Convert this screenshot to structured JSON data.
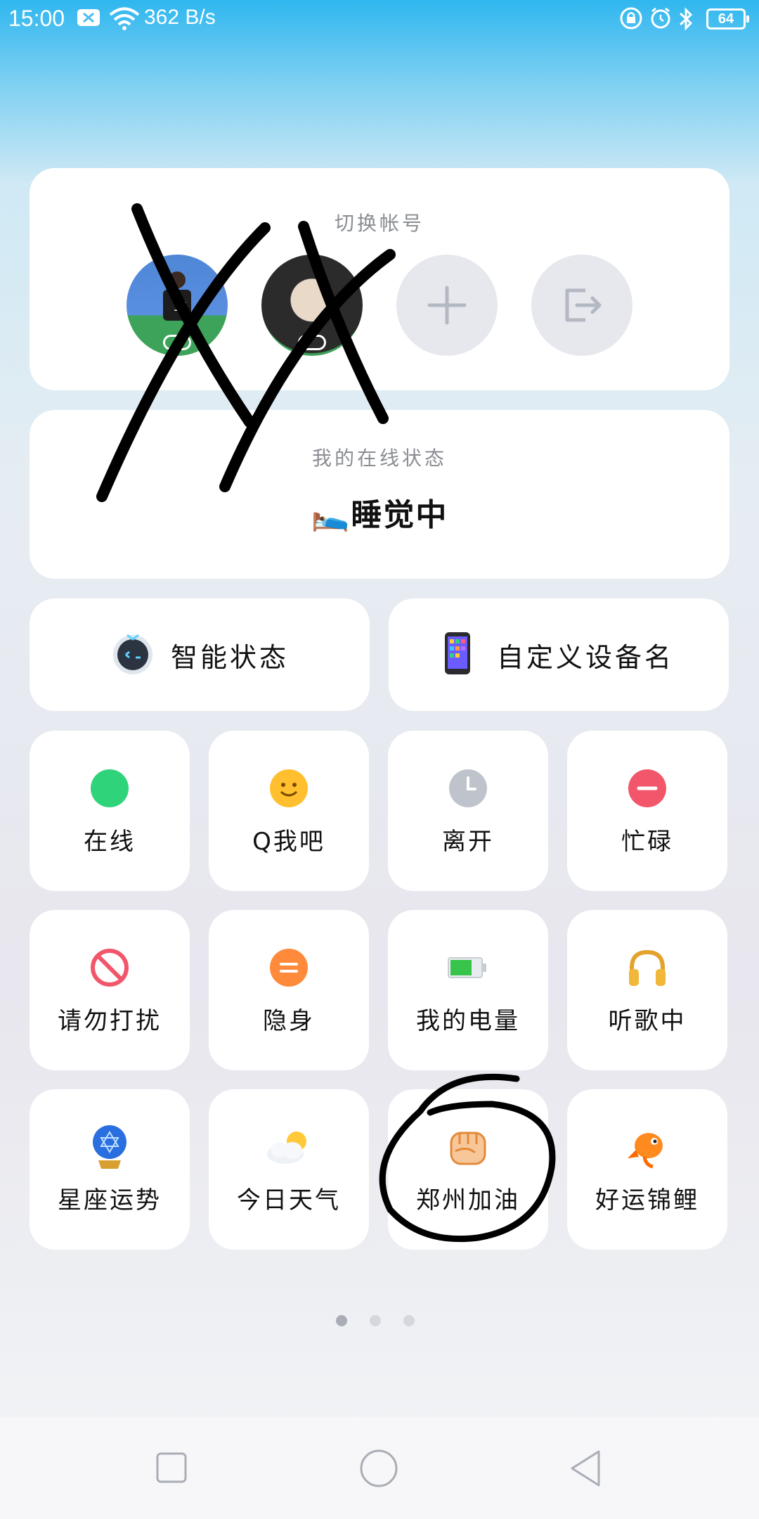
{
  "status_bar": {
    "time": "15:00",
    "network_speed": "362 B/s",
    "battery_level": "64",
    "icons": [
      "notification-icon",
      "wifi-icon",
      "lock-icon",
      "alarm-icon",
      "bluetooth-icon",
      "battery-icon"
    ]
  },
  "accounts": {
    "title": "切换帐号",
    "items": [
      {
        "type": "avatar",
        "icon": "avatar-1"
      },
      {
        "type": "avatar",
        "icon": "avatar-2"
      },
      {
        "type": "action",
        "icon": "plus-icon"
      },
      {
        "type": "action",
        "icon": "logout-icon"
      }
    ]
  },
  "online_status": {
    "title": "我的在线状态",
    "emoji": "🛌",
    "value": "睡觉中"
  },
  "smart_status": {
    "label": "智能状态",
    "icon": "robot-icon"
  },
  "custom_device": {
    "label": "自定义设备名",
    "icon": "phone-icon"
  },
  "tiles": [
    {
      "label": "在线",
      "icon": "green-dot-icon"
    },
    {
      "label": "Q我吧",
      "icon": "smile-icon"
    },
    {
      "label": "离开",
      "icon": "clock-icon"
    },
    {
      "label": "忙碌",
      "icon": "minus-circle-icon"
    },
    {
      "label": "请勿打扰",
      "icon": "no-entry-icon"
    },
    {
      "label": "隐身",
      "icon": "equal-circle-icon"
    },
    {
      "label": "我的电量",
      "icon": "battery-icon"
    },
    {
      "label": "听歌中",
      "icon": "headphones-icon"
    },
    {
      "label": "星座运势",
      "icon": "crystal-ball-icon"
    },
    {
      "label": "今日天气",
      "icon": "weather-icon"
    },
    {
      "label": "郑州加油",
      "icon": "fist-icon"
    },
    {
      "label": "好运锦鲤",
      "icon": "koi-icon"
    }
  ],
  "pager": {
    "pages": 3,
    "current": 1
  },
  "nav": {
    "buttons": [
      "recent-apps-button",
      "home-button",
      "back-button"
    ]
  },
  "colors": {
    "accent_blue": "#2fb7ef",
    "online_green": "#2fd47a",
    "busy_red": "#f2566b",
    "hide_orange": "#ff8a3c",
    "away_gray": "#bfc3cc"
  }
}
